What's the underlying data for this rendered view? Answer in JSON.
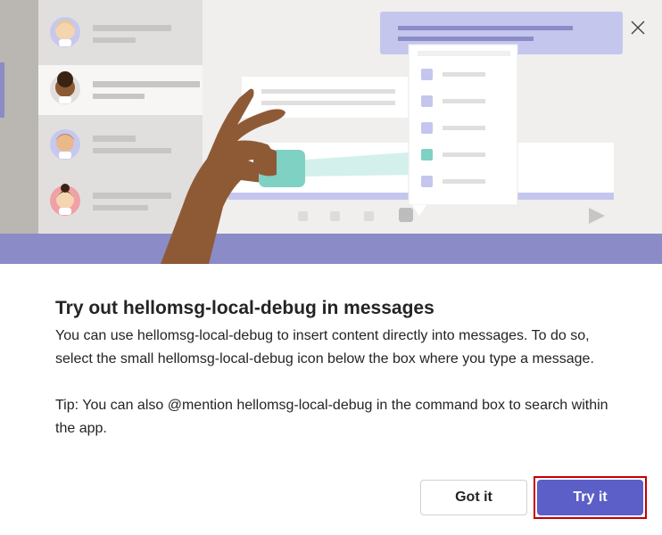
{
  "dialog": {
    "title": "Try out hellomsg-local-debug in messages",
    "description": "You can use hellomsg-local-debug to insert content directly into messages. To do so, select the small hellomsg-local-debug icon below the box where you type a message.",
    "tip": "Tip: You can also @mention hellomsg-local-debug in the command box to search within the app.",
    "close_icon": "close-icon"
  },
  "buttons": {
    "got_it": "Got it",
    "try_it": "Try it"
  },
  "colors": {
    "primary": "#5b5fc7",
    "highlight_border": "#c40000",
    "hero_bg": "#f0efee",
    "hero_band": "#8b8cc7"
  }
}
